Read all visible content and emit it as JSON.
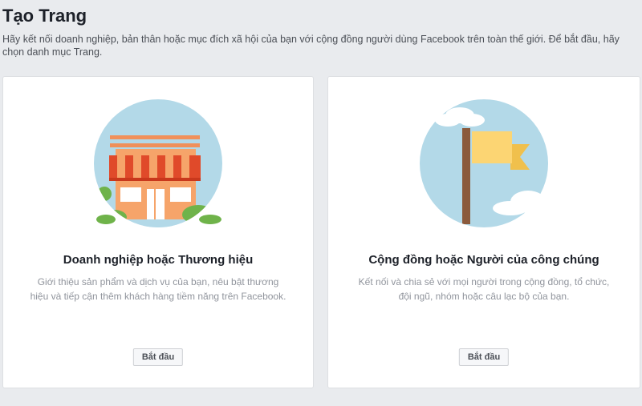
{
  "page": {
    "title": "Tạo Trang",
    "description": "Hãy kết nối doanh nghiệp, bản thân hoặc mục đích xã hội của bạn với cộng đồng người dùng Facebook trên toàn thế giới. Để bắt đầu, hãy chọn danh mục Trang."
  },
  "cards": [
    {
      "title": "Doanh nghiệp hoặc Thương hiệu",
      "description": "Giới thiệu sản phẩm và dịch vụ của bạn, nêu bật thương hiệu và tiếp cận thêm khách hàng tiềm năng trên Facebook.",
      "button_label": "Bắt đầu",
      "icon": "storefront-icon"
    },
    {
      "title": "Cộng đồng hoặc Người của công chúng",
      "description": "Kết nối và chia sẻ với mọi người trong cộng đồng, tổ chức, đội ngũ, nhóm hoặc câu lạc bộ của bạn.",
      "button_label": "Bắt đầu",
      "icon": "flag-icon"
    }
  ],
  "colors": {
    "background": "#e9ebee",
    "card": "#ffffff",
    "illustration_circle": "#b3d9e8",
    "awning_red": "#e04a2a",
    "building_orange": "#f6a46a",
    "flag_yellow": "#fcd573",
    "pole_brown": "#8b5a3c",
    "bush_green": "#6fb34a"
  }
}
